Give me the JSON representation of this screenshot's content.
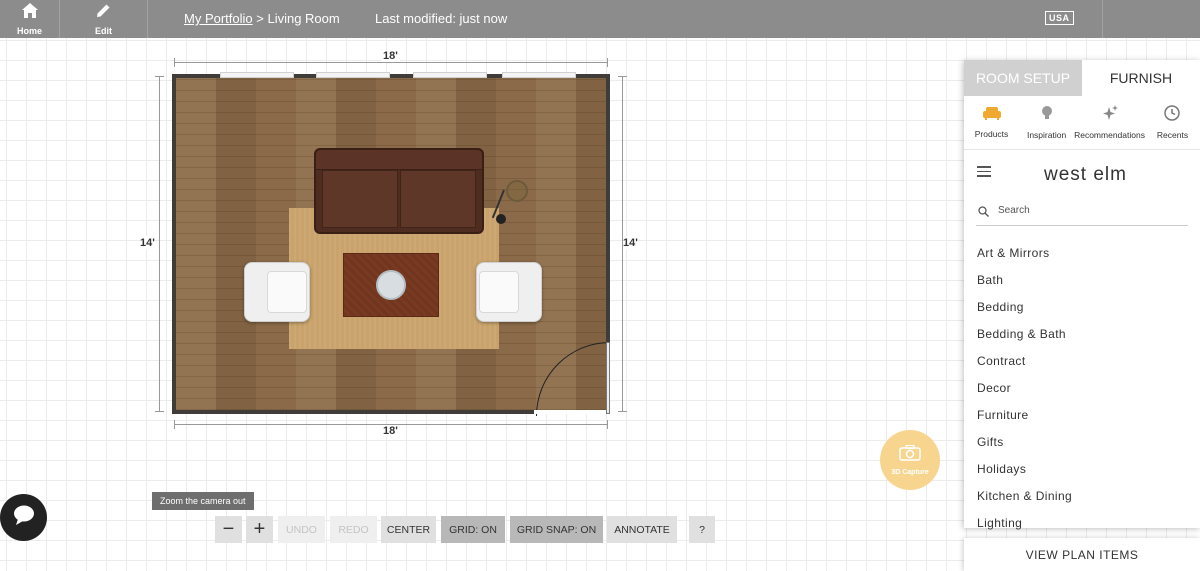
{
  "topbar": {
    "home_label": "Home",
    "edit_label": "Edit",
    "breadcrumb_link": "My Portfolio",
    "breadcrumb_sep": " > ",
    "breadcrumb_current": "Living Room",
    "last_modified": "Last modified: just now",
    "region": "USA"
  },
  "plan": {
    "dim_top": "18'",
    "dim_bottom": "18'",
    "dim_left": "14'",
    "dim_right": "14'"
  },
  "panel": {
    "tabs": [
      {
        "label": "ROOM SETUP"
      },
      {
        "label": "FURNISH"
      }
    ],
    "subtabs": [
      {
        "label": "Products",
        "icon": "sofa-icon"
      },
      {
        "label": "Inspiration",
        "icon": "lightbulb-icon"
      },
      {
        "label": "Recommendations",
        "icon": "sparkle-icon"
      },
      {
        "label": "Recents",
        "icon": "clock-icon"
      }
    ],
    "brand": "west elm",
    "search_placeholder": "Search",
    "categories": [
      "Art & Mirrors",
      "Bath",
      "Bedding",
      "Bedding & Bath",
      "Contract",
      "Decor",
      "Furniture",
      "Gifts",
      "Holidays",
      "Kitchen & Dining",
      "Lighting"
    ],
    "view_plan_items": "VIEW PLAN ITEMS"
  },
  "toolbar": {
    "tooltip": "Zoom the camera out",
    "zoom_out": "−",
    "zoom_in": "+",
    "undo": "UNDO",
    "redo": "REDO",
    "center": "CENTER",
    "grid": "GRID: ON",
    "grid_snap": "GRID SNAP: ON",
    "annotate": "ANNOTATE",
    "help": "?"
  },
  "capture_label": "3D Capture",
  "colors": {
    "topbar": "#8c8c8c",
    "accent_orange": "#f0a830",
    "capture": "#f8d58f",
    "wall": "#3f3c39"
  }
}
